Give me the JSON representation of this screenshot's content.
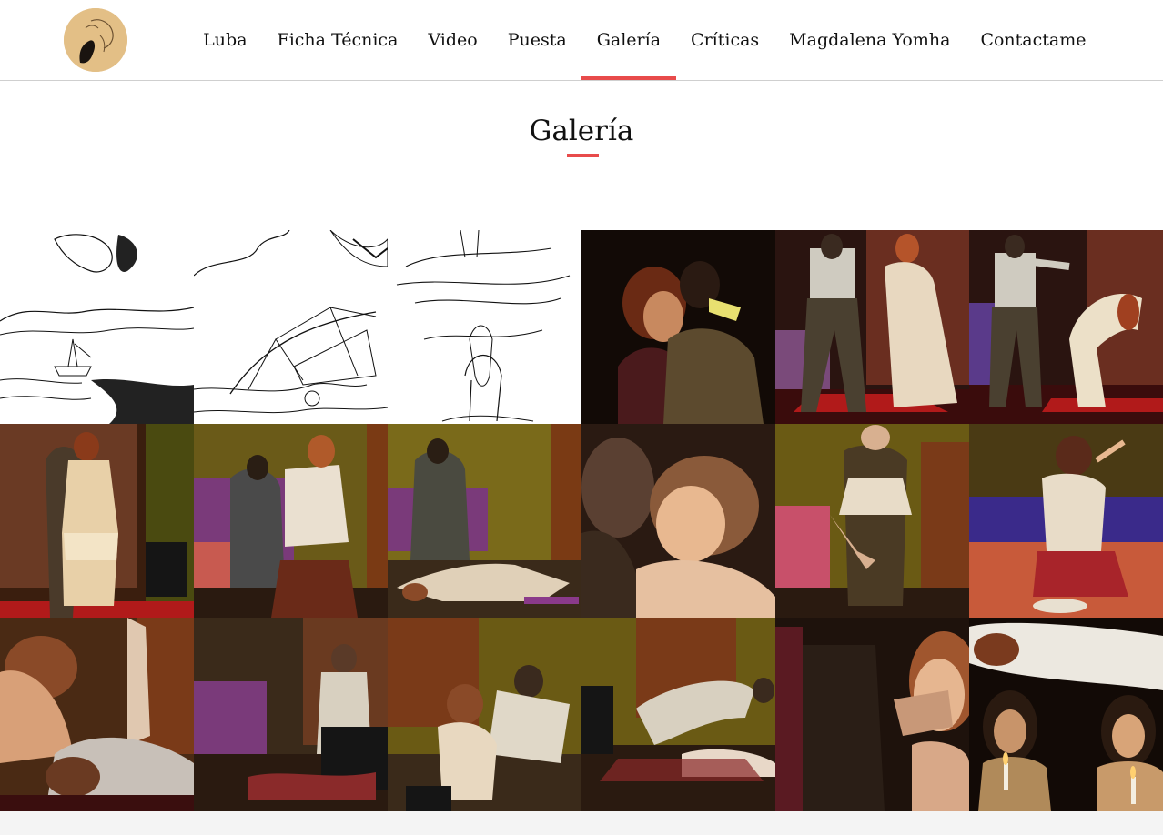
{
  "nav": {
    "items": [
      {
        "label": "Luba"
      },
      {
        "label": "Ficha Técnica"
      },
      {
        "label": "Video"
      },
      {
        "label": "Puesta"
      },
      {
        "label": "Galería",
        "active": true
      },
      {
        "label": "Críticas"
      },
      {
        "label": "Magdalena Yomha"
      },
      {
        "label": "Contactame"
      }
    ]
  },
  "page": {
    "title": "Galería"
  },
  "gallery": {
    "photos": [
      "sketch-mermaid-ship",
      "sketch-ship-net",
      "sketch-sea-figure",
      "stage-couple-embrace",
      "stage-man-woman-gown",
      "stage-man-woman-bending",
      "stage-woman-corset",
      "stage-woman-undressing",
      "stage-woman-floor",
      "stage-closeup-faces",
      "stage-woman-carried",
      "stage-woman-bed",
      "stage-woman-over-man",
      "stage-man-suitcase",
      "stage-couple-floor",
      "stage-man-lying-floor",
      "stage-woman-hand-mouth",
      "stage-candles-levitation"
    ]
  },
  "colors": {
    "accent": "#e84b4b",
    "logo_bg": "#e3bf86",
    "divider": "#cfcfcf"
  }
}
